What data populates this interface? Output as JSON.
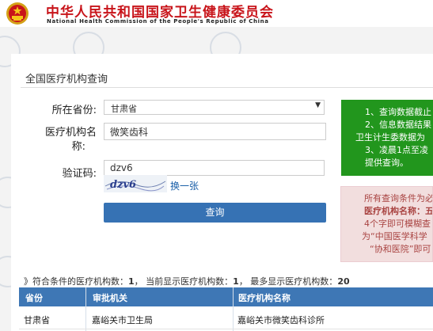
{
  "header": {
    "title_cn": "中华人民共和国国家卫生健康委员会",
    "title_en": "National Health Commission of the People's Republic of China",
    "emblem_icon": "national-emblem-icon"
  },
  "page": {
    "title": "全国医疗机构查询"
  },
  "form": {
    "province_label": "所在省份:",
    "province_value": "甘肃省",
    "institution_label_line1": "医疗机构名",
    "institution_label_line2": "称:",
    "institution_value": "微笑齿科",
    "captcha_label": "验证码:",
    "captcha_value": "dzv6",
    "captcha_image_text": "dzv6",
    "refresh_link": "换一张",
    "submit_label": "查询"
  },
  "notice_green": {
    "lines": [
      "1、查询数据截止",
      "2、信息数据结果",
      "卫生计生委数据为",
      "3、凌晨1点至凌",
      "提供查询。"
    ]
  },
  "notice_red": {
    "lines": [
      "所有查询条件为必",
      "医疗机构名称：五",
      "4个字即可模糊查",
      "为“中国医学科学",
      "“协和医院”即可"
    ]
  },
  "summary": {
    "prefix": "》符合条件的医疗机构数：",
    "count": "1",
    "mid": "， 当前显示医疗机构数：",
    "shown": "1",
    "mid2": "， 最多显示医疗机构数：",
    "max": "20"
  },
  "table": {
    "headers": [
      "省份",
      "审批机关",
      "医疗机构名称"
    ],
    "rows": [
      [
        "甘肃省",
        "嘉峪关市卫生局",
        "嘉峪关市微笑齿科诊所"
      ]
    ]
  },
  "colors": {
    "brand_red": "#c8141a",
    "button_blue": "#3672b4",
    "table_header_blue": "#3e77b5",
    "notice_green": "#22961d",
    "notice_red_bg": "#f2dede",
    "notice_red_text": "#a94442"
  }
}
